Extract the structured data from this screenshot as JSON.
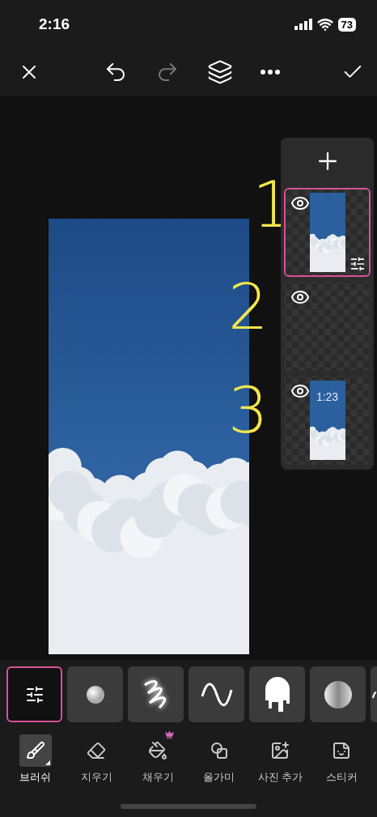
{
  "status_bar": {
    "time": "2:16",
    "battery": "73"
  },
  "toolbar": {
    "redo_enabled": false
  },
  "canvas": {
    "marks": [
      "1",
      "2",
      "3"
    ]
  },
  "layers": [
    {
      "kind": "photo",
      "visible": true,
      "selected": true
    },
    {
      "kind": "empty",
      "visible": true,
      "selected": false
    },
    {
      "kind": "screenshot",
      "visible": true,
      "selected": false,
      "clock": "1:23"
    }
  ],
  "brushes": [
    {
      "kind": "settings",
      "selected": true
    },
    {
      "kind": "dot",
      "selected": false
    },
    {
      "kind": "scribble",
      "selected": false
    },
    {
      "kind": "wave",
      "selected": false
    },
    {
      "kind": "drip",
      "selected": false
    },
    {
      "kind": "sphere",
      "selected": false
    },
    {
      "kind": "partial",
      "selected": false
    }
  ],
  "tools": [
    {
      "kind": "brush",
      "label": "브러쉬",
      "selected": true,
      "premium": false
    },
    {
      "kind": "eraser",
      "label": "지우기",
      "selected": false,
      "premium": false
    },
    {
      "kind": "fill",
      "label": "채우기",
      "selected": false,
      "premium": true
    },
    {
      "kind": "lasso",
      "label": "올가미",
      "selected": false,
      "premium": false
    },
    {
      "kind": "photo",
      "label": "사진 추가",
      "selected": false,
      "premium": false
    },
    {
      "kind": "sticker",
      "label": "스티커",
      "selected": false,
      "premium": false
    }
  ]
}
